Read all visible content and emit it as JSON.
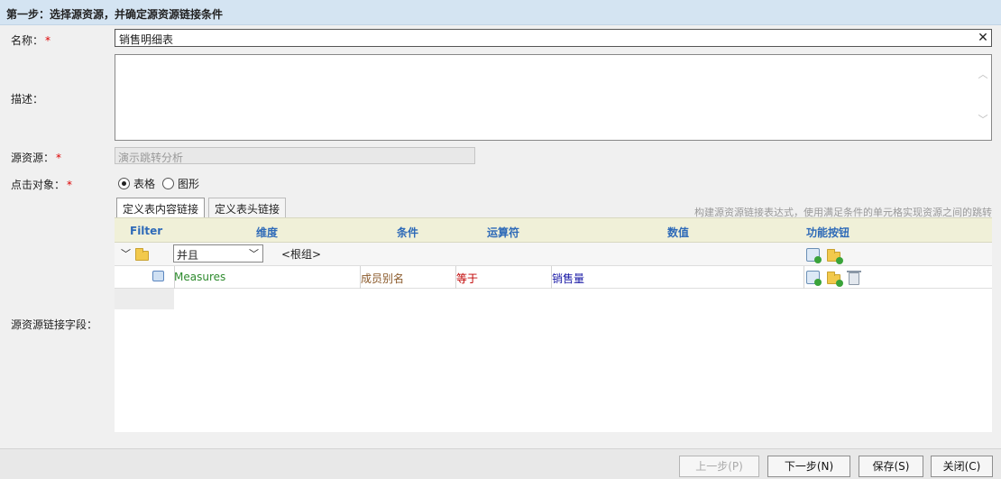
{
  "header": {
    "title": "第一步：选择源资源，并确定源资源链接条件"
  },
  "form": {
    "name_label": "名称：",
    "name_value": "销售明细表",
    "desc_label": "描述：",
    "source_label": "源资源：",
    "source_value": "演示跳转分析",
    "click_target_label": "点击对象：",
    "click_options": [
      "表格",
      "图形"
    ],
    "link_field_label": "源资源链接字段：",
    "required_mark": "*"
  },
  "tabs": [
    {
      "label": "定义表内容链接",
      "active": true
    },
    {
      "label": "定义表头链接",
      "active": false
    }
  ],
  "hint": "构建源资源链接表达式，使用满足条件的单元格实现资源之间的跳转",
  "grid": {
    "columns": [
      "Filter",
      "维度",
      "条件",
      "运算符",
      "数值",
      "功能按钮"
    ],
    "root_row": {
      "logic": "并且",
      "group": "<根组>"
    },
    "condition_row": {
      "dimension": "Measures",
      "condition": "成员别名",
      "operator": "等于",
      "value": "销售量"
    }
  },
  "colors": {
    "header_bg": "#d4e4f2",
    "column_text": "#2e6ab8",
    "dimension_text": "#2e8b2e",
    "condition_text": "#8b5a2b",
    "operator_text": "#c00000",
    "value_text": "#1a1aa6"
  },
  "buttons": {
    "prev": "上一步(P)",
    "next": "下一步(N)",
    "save": "保存(S)",
    "close": "关闭(C)"
  }
}
